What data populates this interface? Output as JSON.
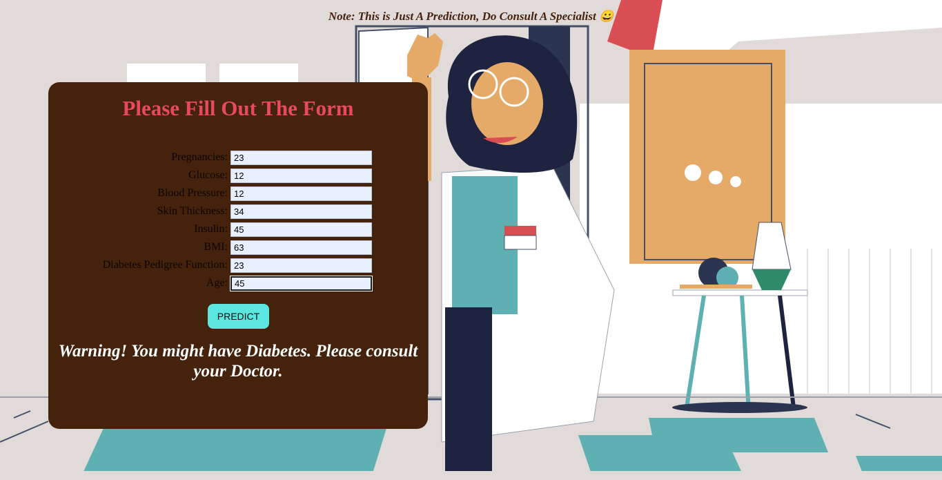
{
  "note": "Note: This is Just A Prediction, Do Consult A Specialist 😀",
  "form": {
    "title": "Please Fill Out The Form",
    "fields": [
      {
        "label": "Pregnancies:",
        "value": "23"
      },
      {
        "label": "Glucose:",
        "value": "12"
      },
      {
        "label": "Blood Pressure:",
        "value": "12"
      },
      {
        "label": "Skin Thickness:",
        "value": "34"
      },
      {
        "label": "Insulin:",
        "value": "45"
      },
      {
        "label": "BMI:",
        "value": "63"
      },
      {
        "label": "Diabetes Pedigree Function:",
        "value": "23"
      },
      {
        "label": "Age:",
        "value": "45"
      }
    ],
    "predict_label": "PREDICT",
    "result": "Warning! You might have Diabetes. Please consult your Doctor."
  },
  "colors": {
    "card_bg": "#44220b",
    "title": "#e84a5a",
    "button": "#5ce6e0",
    "input_bg": "#e8f0fe"
  },
  "background_illustration": "doctor-waving-clinic-illustration"
}
